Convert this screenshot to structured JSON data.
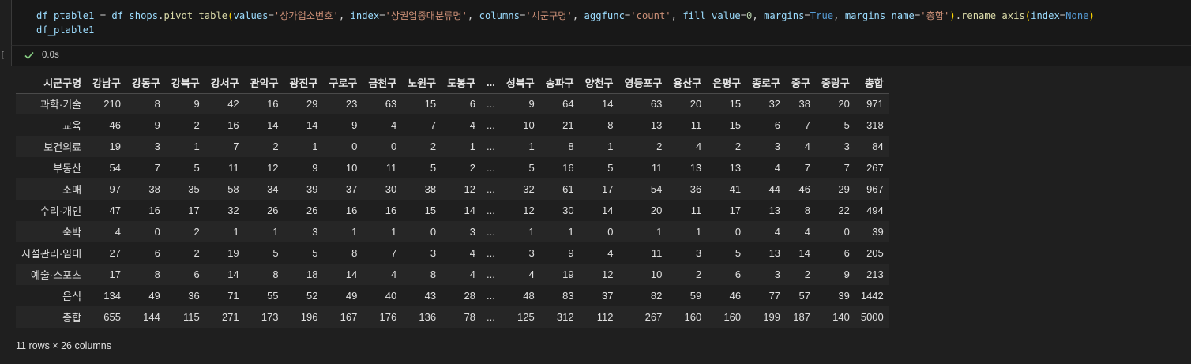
{
  "code": {
    "line1": {
      "var": "df_ptable1",
      "eq": " = ",
      "obj": "df_shops",
      "dot": ".",
      "fn": "pivot_table",
      "open": "(",
      "k_values": "values",
      "v_values": "'상가업소번호'",
      "k_index": "index",
      "v_index": "'상권업종대분류명'",
      "k_columns": "columns",
      "v_columns": "'시군구명'",
      "k_aggfunc": "aggfunc",
      "v_aggfunc": "'count'",
      "k_fill": "fill_value",
      "v_fill": "0",
      "k_margins": "margins",
      "v_margins": "True",
      "k_mname": "margins_name",
      "v_mname": "'총합'",
      "close": ")",
      "fn2": "rename_axis",
      "k_index2": "index",
      "v_index2": "None",
      "close2": ")"
    },
    "line2": "df_ptable1"
  },
  "status": {
    "exec_time": "0.0s",
    "bracket": "["
  },
  "table": {
    "axis_label": "시군구명",
    "columns": [
      "강남구",
      "강동구",
      "강북구",
      "강서구",
      "관악구",
      "광진구",
      "구로구",
      "금천구",
      "노원구",
      "도봉구",
      "...",
      "성북구",
      "송파구",
      "양천구",
      "영등포구",
      "용산구",
      "은평구",
      "종로구",
      "중구",
      "중랑구",
      "총합"
    ],
    "rows": [
      {
        "index": "과학·기술",
        "values": [
          "210",
          "8",
          "9",
          "42",
          "16",
          "29",
          "23",
          "63",
          "15",
          "6",
          "...",
          "9",
          "64",
          "14",
          "63",
          "20",
          "15",
          "32",
          "38",
          "20",
          "971"
        ]
      },
      {
        "index": "교육",
        "values": [
          "46",
          "9",
          "2",
          "16",
          "14",
          "14",
          "9",
          "4",
          "7",
          "4",
          "...",
          "10",
          "21",
          "8",
          "13",
          "11",
          "15",
          "6",
          "7",
          "5",
          "318"
        ]
      },
      {
        "index": "보건의료",
        "values": [
          "19",
          "3",
          "1",
          "7",
          "2",
          "1",
          "0",
          "0",
          "2",
          "1",
          "...",
          "1",
          "8",
          "1",
          "2",
          "4",
          "2",
          "3",
          "4",
          "3",
          "84"
        ]
      },
      {
        "index": "부동산",
        "values": [
          "54",
          "7",
          "5",
          "11",
          "12",
          "9",
          "10",
          "11",
          "5",
          "2",
          "...",
          "5",
          "16",
          "5",
          "11",
          "13",
          "13",
          "4",
          "7",
          "7",
          "267"
        ]
      },
      {
        "index": "소매",
        "values": [
          "97",
          "38",
          "35",
          "58",
          "34",
          "39",
          "37",
          "30",
          "38",
          "12",
          "...",
          "32",
          "61",
          "17",
          "54",
          "36",
          "41",
          "44",
          "46",
          "29",
          "967"
        ]
      },
      {
        "index": "수리·개인",
        "values": [
          "47",
          "16",
          "17",
          "32",
          "26",
          "26",
          "16",
          "16",
          "15",
          "14",
          "...",
          "12",
          "30",
          "14",
          "20",
          "11",
          "17",
          "13",
          "8",
          "22",
          "494"
        ]
      },
      {
        "index": "숙박",
        "values": [
          "4",
          "0",
          "2",
          "1",
          "1",
          "3",
          "1",
          "1",
          "0",
          "3",
          "...",
          "1",
          "1",
          "0",
          "1",
          "1",
          "0",
          "4",
          "4",
          "0",
          "39"
        ]
      },
      {
        "index": "시설관리·임대",
        "values": [
          "27",
          "6",
          "2",
          "19",
          "5",
          "5",
          "8",
          "7",
          "3",
          "4",
          "...",
          "3",
          "9",
          "4",
          "11",
          "3",
          "5",
          "13",
          "14",
          "6",
          "205"
        ]
      },
      {
        "index": "예술·스포츠",
        "values": [
          "17",
          "8",
          "6",
          "14",
          "8",
          "18",
          "14",
          "4",
          "8",
          "4",
          "...",
          "4",
          "19",
          "12",
          "10",
          "2",
          "6",
          "3",
          "2",
          "9",
          "213"
        ]
      },
      {
        "index": "음식",
        "values": [
          "134",
          "49",
          "36",
          "71",
          "55",
          "52",
          "49",
          "40",
          "43",
          "28",
          "...",
          "48",
          "83",
          "37",
          "82",
          "59",
          "46",
          "77",
          "57",
          "39",
          "1442"
        ]
      },
      {
        "index": "총합",
        "values": [
          "655",
          "144",
          "115",
          "271",
          "173",
          "196",
          "167",
          "176",
          "136",
          "78",
          "...",
          "125",
          "312",
          "112",
          "267",
          "160",
          "160",
          "199",
          "187",
          "140",
          "5000"
        ]
      }
    ],
    "shape": "11 rows × 26 columns"
  },
  "colors": {
    "check": "#89d185",
    "background": "#1f1f1f"
  }
}
